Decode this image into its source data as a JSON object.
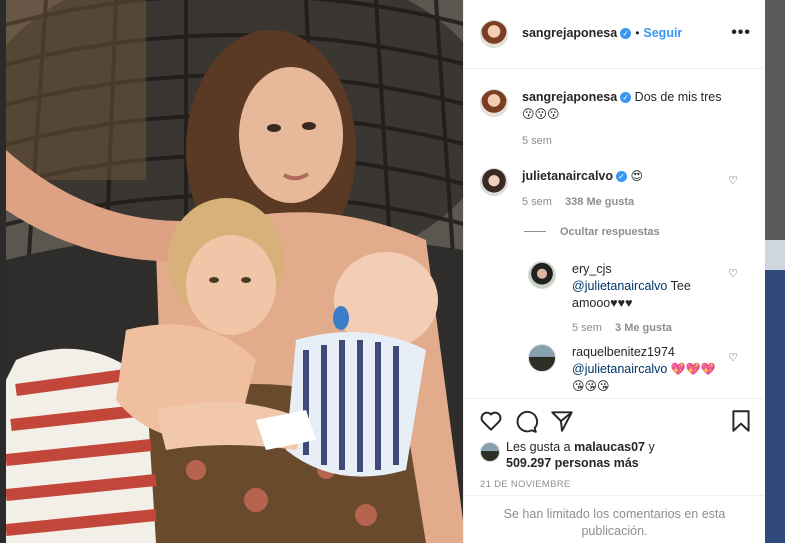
{
  "post": {
    "author": "sangrejaponesa",
    "follow_label": "Seguir",
    "dot": "•",
    "more_label": "•••",
    "caption": {
      "username": "sangrejaponesa",
      "text": "Dos de mis tres",
      "emojis": "😗😗😗",
      "time": "5 sem"
    }
  },
  "comments": [
    {
      "username": "julietanaircalvo",
      "text": "😍",
      "time": "5 sem",
      "likes": "338 Me gusta",
      "hide_replies": "Ocultar respuestas",
      "replies": [
        {
          "username": "ery_cjs",
          "mention": "@julietanaircalvo",
          "text": "Tee amooo♥♥♥",
          "time": "5 sem",
          "likes": "3 Me gusta"
        },
        {
          "username": "raquelbenitez1974",
          "mention": "@julietanaircalvo",
          "text": "💖💖💖",
          "text2": "😘😘😘"
        }
      ]
    }
  ],
  "footer": {
    "likes_prefix": "Les gusta a",
    "likes_user": "malaucas07",
    "likes_and": "y",
    "likes_count": "509.297 personas más",
    "date": "21 DE NOVIEMBRE",
    "limited_line1": "Se han limitado los comentarios en esta",
    "limited_line2": "publicación."
  },
  "icons": {
    "like": "heart-icon",
    "comment": "comment-icon",
    "share": "share-icon",
    "save": "bookmark-icon",
    "verified": "verified-badge-icon",
    "options": "more-options-icon"
  },
  "colors": {
    "accent": "#3897f0",
    "text": "#262626",
    "muted": "#8e8e8e",
    "border": "#efefef"
  }
}
